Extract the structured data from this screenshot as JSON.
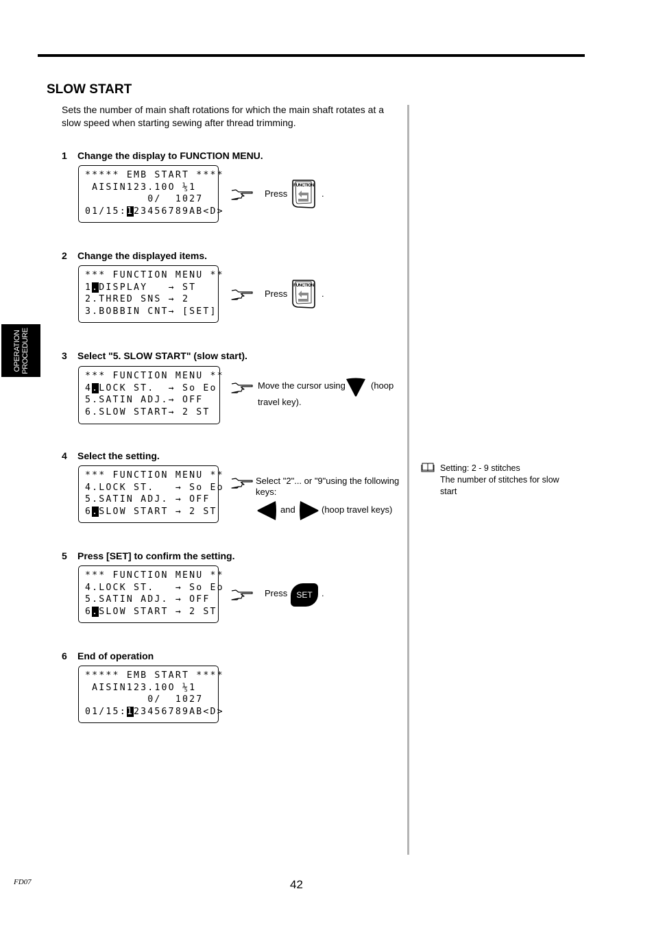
{
  "page": {
    "title": "SLOW START",
    "intro": "Sets the number of main shaft rotations for which the main shaft rotates at a slow speed when starting sewing after thread trimming.",
    "side_tab": [
      "OPERATION",
      "PROCEDURE"
    ],
    "footer_code": "FD07",
    "page_number": "42"
  },
  "icons": {
    "hand": "pointing-hand-icon",
    "function_key": "function-key-icon",
    "down": "down-triangle-icon",
    "left": "left-triangle-icon",
    "right": "right-triangle-icon",
    "set": "set-key-icon",
    "book": "book-icon"
  },
  "steps": [
    {
      "num": "1",
      "heading": "Change the display to FUNCTION MENU.",
      "lcd": [
        {
          "pre": "***** EMB START ****",
          "cur": "",
          "post": ""
        },
        {
          "pre": " AISIN123.10O ",
          "cur": "",
          "post": "⅕1"
        },
        {
          "pre": "         0/  1027",
          "cur": "",
          "post": ""
        },
        {
          "pre": "01/15:",
          "cur": "1",
          "post": "23456789AB<D>"
        }
      ],
      "instruction": "Press",
      "key_label": "FUNCTION",
      "suffix": "."
    },
    {
      "num": "2",
      "heading": "Change the displayed items.",
      "lcd": [
        {
          "pre": "*** FUNCTION MENU **",
          "cur": "",
          "post": ""
        },
        {
          "pre": "1",
          "cur": ".",
          "post": "DISPLAY   → ST"
        },
        {
          "pre": "2.THRED SNS → 2",
          "cur": "",
          "post": ""
        },
        {
          "pre": "3.BOBBIN CNT→ [SET]",
          "cur": "",
          "post": ""
        }
      ],
      "instruction": "Press",
      "key_label": "FUNCTION",
      "suffix": "."
    },
    {
      "num": "3",
      "heading": "Select \"5. SLOW START\" (slow start).",
      "lcd": [
        {
          "pre": "*** FUNCTION MENU **",
          "cur": "",
          "post": ""
        },
        {
          "pre": "4",
          "cur": ".",
          "post": "LOCK ST.  → So Eo"
        },
        {
          "pre": "5.SATIN ADJ.→ OFF",
          "cur": "",
          "post": ""
        },
        {
          "pre": "6.SLOW START→ 2 ST",
          "cur": "",
          "post": ""
        }
      ],
      "instruction_a": "Move the cursor using",
      "instruction_b": "(hoop",
      "instruction_c": "travel key)."
    },
    {
      "num": "4",
      "heading": "Select the setting.",
      "lcd": [
        {
          "pre": "*** FUNCTION MENU **",
          "cur": "",
          "post": ""
        },
        {
          "pre": "4.LOCK ST.   → So Eo",
          "cur": "",
          "post": ""
        },
        {
          "pre": "5.SATIN ADJ. → OFF",
          "cur": "",
          "post": ""
        },
        {
          "pre": "6",
          "cur": ".",
          "post": "SLOW START → 2 ST"
        }
      ],
      "instruction_a": "Select \"2\"... or \"9\"using the following keys:",
      "and_label": "and",
      "keys_label": "(hoop travel keys)"
    },
    {
      "num": "5",
      "heading": "Press [SET] to confirm the setting.",
      "lcd": [
        {
          "pre": "*** FUNCTION MENU **",
          "cur": "",
          "post": ""
        },
        {
          "pre": "4.LOCK ST.   → So Eo",
          "cur": "",
          "post": ""
        },
        {
          "pre": "5.SATIN ADJ. → OFF",
          "cur": "",
          "post": ""
        },
        {
          "pre": "6",
          "cur": ".",
          "post": "SLOW START → 2 ST"
        }
      ],
      "instruction": "Press",
      "key_label": "SET",
      "suffix": "."
    },
    {
      "num": "6",
      "heading": "End of operation",
      "lcd": [
        {
          "pre": "***** EMB START ****",
          "cur": "",
          "post": ""
        },
        {
          "pre": " AISIN123.10O ",
          "cur": "",
          "post": "⅕1"
        },
        {
          "pre": "         0/  1027",
          "cur": "",
          "post": ""
        },
        {
          "pre": "01/15:",
          "cur": "1",
          "post": "23456789AB<D>"
        }
      ]
    }
  ],
  "note": {
    "line1": "Setting:  2 - 9 stitches",
    "line2": "The number of stitches for slow start"
  }
}
